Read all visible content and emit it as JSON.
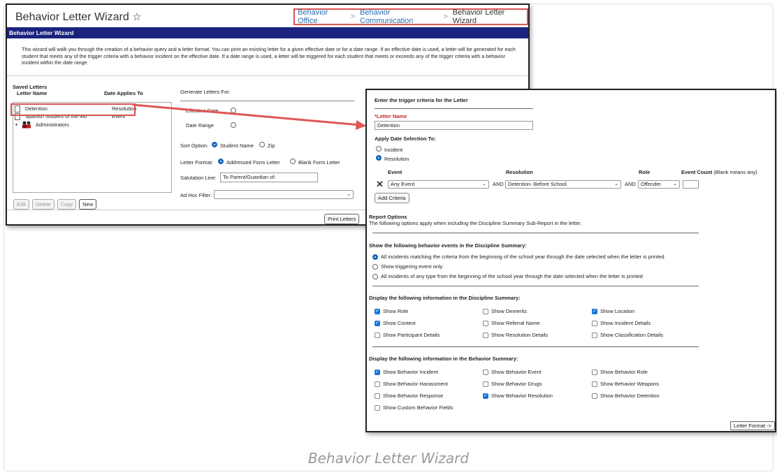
{
  "caption": "Behavior Letter Wizard",
  "window": {
    "title": "Behavior Letter Wizard",
    "star_glyph": "☆",
    "breadcrumb": {
      "item1": "Behavior Office",
      "item2": "Behavior Communication",
      "current": "Behavior Letter Wizard",
      "separator": ">"
    },
    "bar_title": "Behavior Letter Wizard",
    "intro": "This wizard will walk you through the creation of a behavior query and a letter format. You can print an existing letter for a given effective date or for a date range. If an effective date is used, a letter will be generated for each student that meets any of the trigger criteria with a behavior incident on the effective date. If a date range is used, a letter will be triggered for each student that meets or exceeds any of the trigger criteria with a behavior incident within the date range."
  },
  "saved_letters": {
    "heading": "Saved Letters",
    "col_name": "Letter Name",
    "col_date": "Date Applies To",
    "rows": [
      {
        "name": "Detention",
        "applies": "Resolution"
      },
      {
        "name": "Spanish Student of the Mo",
        "applies": "Event"
      }
    ],
    "folder": {
      "expand": "+",
      "name": "Administrators"
    },
    "buttons": {
      "edit": "Edit",
      "delete": "Delete",
      "copy": "Copy",
      "new": "New"
    }
  },
  "generate": {
    "heading": "Generate Letters For:",
    "effective_date": "Effective Date",
    "date_range": "Date Range",
    "sort_label": "Sort Option:",
    "sort_student": "Student Name",
    "sort_zip": "Zip",
    "format_label": "Letter Format:",
    "format_addressed": "Addressed Form Letter",
    "format_blank": "Blank Form Letter",
    "salutation_label": "Salutation Line:",
    "salutation_value": "To Parent/Guardian of:",
    "adhoc_label": "Ad Hoc Filter:",
    "adhoc_value": "",
    "print_button": "Print Letters"
  },
  "criteria": {
    "heading": "Enter the trigger criteria for the Letter",
    "letter_name_label": "*Letter Name",
    "letter_name_value": "Detention",
    "apply_label": "Apply Date Selection To:",
    "incident": "Incident",
    "resolution": "Resolution",
    "col_event": "Event",
    "col_resolution": "Resolution",
    "col_role": "Role",
    "col_count": "Event Count",
    "col_count_note": "(Blank means any)",
    "remove_glyph": "✕",
    "event_value": "Any Event",
    "and1": "AND",
    "resolution_value": "Detention- Before School",
    "and2": "AND",
    "role_value": "Offender",
    "count_value": "",
    "add_button": "Add Criteria"
  },
  "report": {
    "heading": "Report Options",
    "note": "The following options apply when including the Discipline Summary Sub-Report in the letter.",
    "events_heading": "Show the following behavior events in the Discipline Summary:",
    "events": [
      "All incidents matching the criteria from the beginning of the school year through the date selected when the letter is printed",
      "Show triggering event only",
      "All incidents of any type from the beginning of the school year through the date selected when the letter is printed"
    ],
    "disc_heading": "Display the following information in the Discipline Summary:",
    "disc": [
      {
        "label": "Show Role",
        "checked": true
      },
      {
        "label": "Show Demerits",
        "checked": false
      },
      {
        "label": "Show Location",
        "checked": true
      },
      {
        "label": "Show Context",
        "checked": true
      },
      {
        "label": "Show Referral Name",
        "checked": false
      },
      {
        "label": "Show Incident Details",
        "checked": false
      },
      {
        "label": "Show Participant Details",
        "checked": false
      },
      {
        "label": "Show Resolution Details",
        "checked": false
      },
      {
        "label": "Show Classification Details",
        "checked": false
      }
    ],
    "beh_heading": "Display the following information in the Behavior Summary:",
    "beh": [
      {
        "label": "Show Behavior Incident",
        "checked": true
      },
      {
        "label": "Show Behavior Event",
        "checked": false
      },
      {
        "label": "Show Behavior Role",
        "checked": false
      },
      {
        "label": "Show Behavior Harassment",
        "checked": false
      },
      {
        "label": "Show Behavior Drugs",
        "checked": false
      },
      {
        "label": "Show Behavior Weapons",
        "checked": false
      },
      {
        "label": "Show Behavior Response",
        "checked": false
      },
      {
        "label": "Show Behavior Resolution",
        "checked": true
      },
      {
        "label": "Show Behavior Detention",
        "checked": false
      },
      {
        "label": "Show Custom Behavior Fields",
        "checked": false
      }
    ],
    "next_button": "Letter Format ->"
  },
  "colors": {
    "header_bar": "#1a237e",
    "highlight": "#d9534f",
    "link": "#2a6db0",
    "checkbox": "#1976d2"
  }
}
